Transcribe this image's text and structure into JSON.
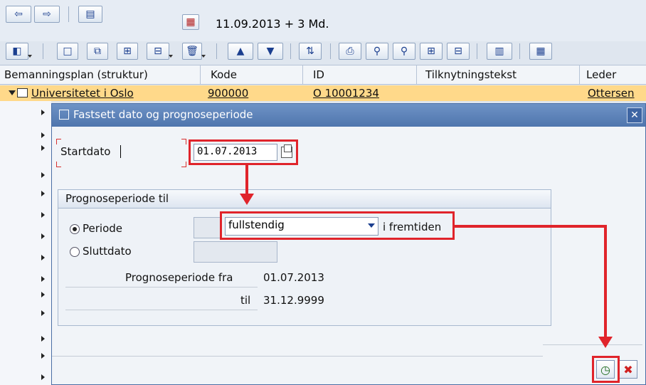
{
  "toolbar": {
    "date_text": "11.09.2013 + 3 Md."
  },
  "table": {
    "headers": [
      "Bemanningsplan (struktur)",
      "Kode",
      "ID",
      "Tilknytningstekst",
      "Leder"
    ],
    "row": {
      "name": "Universitetet i Oslo",
      "kode": "900000",
      "id": "O 10001234",
      "tilknytning": "",
      "leder": "Ottersen"
    }
  },
  "dialog": {
    "title": "Fastsett dato og prognoseperiode",
    "close_label": "✕",
    "startdato_label": "Startdato",
    "startdato_value": "01.07.2013",
    "group_title": "Prognoseperiode til",
    "periode_label": "Periode",
    "periode_selected": true,
    "periode_option": "fullstendig",
    "periode_suffix": "i fremtiden",
    "sluttdato_label": "Sluttdato",
    "sluttdato_selected": false,
    "prog_fra_label": "Prognoseperiode fra",
    "prog_fra_value": "01.07.2013",
    "til_label": "til",
    "til_value": "31.12.9999",
    "ok_icon": "clock-check-icon",
    "cancel_icon": "cancel-x-icon"
  },
  "colors": {
    "highlight": "#e0242b",
    "selected_row": "#ffd98a",
    "title_bar": "#4f75ad"
  }
}
